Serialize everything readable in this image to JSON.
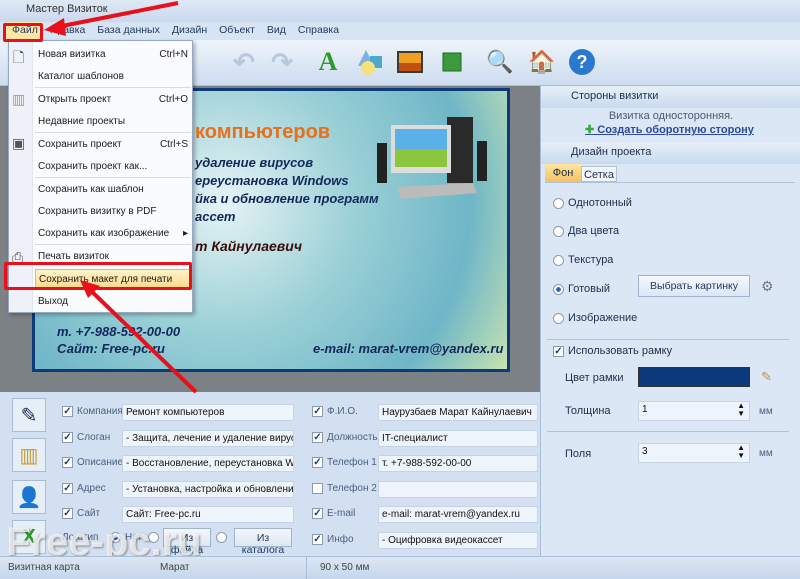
{
  "window": {
    "title": "Мастер Визиток"
  },
  "menubar": [
    "Файл",
    "Правка",
    "База данных",
    "Дизайн",
    "Объект",
    "Вид",
    "Справка"
  ],
  "file_menu": {
    "items": [
      {
        "label": "Новая визитка",
        "shortcut": "Ctrl+N"
      },
      {
        "label": "Каталог шаблонов",
        "shortcut": ""
      },
      {
        "label": "Открыть проект",
        "shortcut": "Ctrl+O"
      },
      {
        "label": "Недавние проекты",
        "shortcut": ""
      },
      {
        "label": "Сохранить проект",
        "shortcut": "Ctrl+S"
      },
      {
        "label": "Сохранить проект как...",
        "shortcut": ""
      },
      {
        "label": "Сохранить как шаблон",
        "shortcut": ""
      },
      {
        "label": "Сохранить визитку в PDF",
        "shortcut": ""
      },
      {
        "label": "Сохранить как изображение",
        "shortcut": "▸"
      },
      {
        "label": "Печать визиток",
        "shortcut": ""
      },
      {
        "label": "Сохранить макет для печати",
        "shortcut": ""
      },
      {
        "label": "Выход",
        "shortcut": ""
      }
    ]
  },
  "card": {
    "company": "компьютеров",
    "lines": [
      "удаление вирусов",
      "ереустановка Windows",
      "йка и обновление программ",
      "ассет"
    ],
    "name": "т Кайнулаевич",
    "phone": "т. +7-988-592-00-00",
    "site": "Сайт: Free-pc.ru",
    "email": "e-mail: marat-vrem@yandex.ru"
  },
  "right": {
    "sides_header": "Стороны визитки",
    "sides_info": "Визитка односторонняя.",
    "create_back": "Создать оборотную сторону",
    "design_header": "Дизайн проекта",
    "tabs": [
      "Фон",
      "Сетка"
    ],
    "bg_options": [
      {
        "label": "Однотонный",
        "on": false
      },
      {
        "label": "Два цвета",
        "on": false
      },
      {
        "label": "Текстура",
        "on": false
      },
      {
        "label": "Готовый",
        "on": true
      },
      {
        "label": "Изображение",
        "on": false
      }
    ],
    "choose_picture": "Выбрать картинку",
    "use_frame": "Использовать рамку",
    "frame_color_label": "Цвет рамки",
    "frame_color": "#0a3a7c",
    "thickness_label": "Толщина",
    "thickness": "1",
    "margins_label": "Поля",
    "margins": "3",
    "unit": "мм"
  },
  "form": {
    "left": [
      {
        "label": "Компания",
        "value": "Ремонт компьютеров",
        "checked": true
      },
      {
        "label": "Слоган",
        "value": "- Защита, лечение и удаление вирусов",
        "checked": true
      },
      {
        "label": "Описание",
        "value": "- Восстановление, переустановка Windows",
        "checked": true
      },
      {
        "label": "Адрес",
        "value": "- Установка, настройка и обновление прогр",
        "checked": true
      },
      {
        "label": "Сайт",
        "value": "Сайт: Free-pc.ru",
        "checked": true
      }
    ],
    "right": [
      {
        "label": "Ф.И.О.",
        "value": "Наурузбаев Марат Кайнулаевич",
        "checked": true
      },
      {
        "label": "Должность",
        "value": "IT-специалист",
        "checked": true
      },
      {
        "label": "Телефон 1",
        "value": "т. +7-988-592-00-00",
        "checked": true
      },
      {
        "label": "Телефон 2",
        "value": "",
        "checked": false
      },
      {
        "label": "E-mail",
        "value": "e-mail: marat-vrem@yandex.ru",
        "checked": true
      },
      {
        "label": "Инфо",
        "value": "- Оцифровка видеокассет",
        "checked": true
      }
    ],
    "logo_label": "Логотип",
    "logo_none": "Нет",
    "from_file": "Из файла",
    "from_catalog": "Из каталога"
  },
  "status": {
    "left": "Визитная карта",
    "mid": "Марат",
    "size": "90 x 50 мм"
  },
  "watermark": "Free-pc.ru"
}
